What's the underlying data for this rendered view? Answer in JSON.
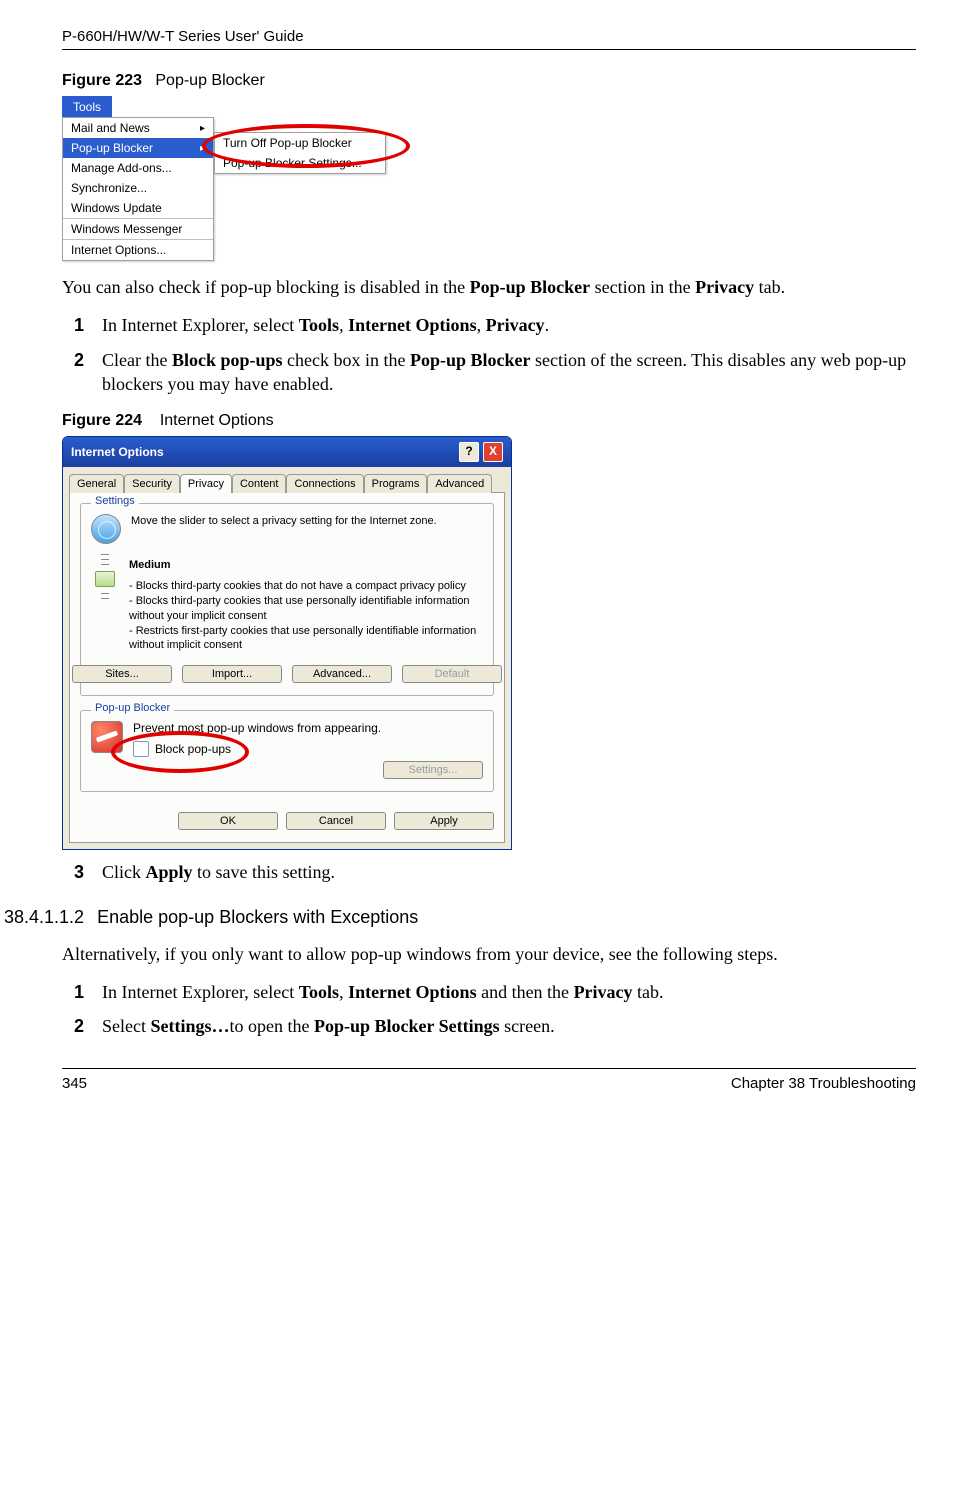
{
  "header": {
    "title": "P-660H/HW/W-T Series User' Guide"
  },
  "fig223": {
    "caption_num": "Figure 223",
    "caption_text": "Pop-up Blocker",
    "tools_label": "Tools",
    "menu": {
      "mail_and_news": "Mail and News",
      "popup_blocker": "Pop-up Blocker",
      "manage_addons": "Manage Add-ons...",
      "synchronize": "Synchronize...",
      "windows_update": "Windows Update",
      "windows_messenger": "Windows Messenger",
      "internet_options": "Internet Options...",
      "arrow": "▸"
    },
    "submenu": {
      "turn_off": "Turn Off Pop-up Blocker",
      "settings": "Pop-up Blocker Settings..."
    }
  },
  "para_after_fig223_a": "You can also check if pop-up blocking is disabled in the ",
  "para_after_fig223_b": "Pop-up Blocker",
  "para_after_fig223_c": " section in the ",
  "para_after_fig223_d": "Privacy",
  "para_after_fig223_e": " tab.",
  "steps1": {
    "s1": {
      "num": "1",
      "a": "In Internet Explorer, select ",
      "b": "Tools",
      "c": ", ",
      "d": "Internet Options",
      "e": ", ",
      "f": "Privacy",
      "g": "."
    },
    "s2": {
      "num": "2",
      "a": "Clear the ",
      "b": "Block pop-ups",
      "c": " check box in the ",
      "d": "Pop-up Blocker",
      "e": " section of the screen. This disables any web pop-up blockers you may have enabled."
    }
  },
  "fig224": {
    "caption_num": "Figure 224",
    "caption_text": "Internet Options",
    "dialog": {
      "title": "Internet Options",
      "help": "?",
      "close": "X",
      "tabs": {
        "general": "General",
        "security": "Security",
        "privacy": "Privacy",
        "content": "Content",
        "connections": "Connections",
        "programs": "Programs",
        "advanced": "Advanced"
      },
      "settings_title": "Settings",
      "settings_intro": "Move the slider to select a privacy setting for the Internet zone.",
      "level": "Medium",
      "bul1": "- Blocks third-party cookies that do not have a compact privacy policy",
      "bul2": "- Blocks third-party cookies that use personally identifiable information without your implicit consent",
      "bul3": "- Restricts first-party cookies that use personally identifiable information without implicit consent",
      "btn_sites": "Sites...",
      "btn_import": "Import...",
      "btn_advanced": "Advanced...",
      "btn_default": "Default",
      "popup_title": "Pop-up Blocker",
      "popup_intro": "Prevent most pop-up windows from appearing.",
      "cb_label": "Block pop-ups",
      "btn_settings": "Settings...",
      "btn_ok": "OK",
      "btn_cancel": "Cancel",
      "btn_apply": "Apply"
    }
  },
  "step3": {
    "num": "3",
    "a": "Click ",
    "b": "Apply",
    "c": " to save this setting."
  },
  "sec": {
    "num": "38.4.1.1.2",
    "title": "Enable pop-up Blockers with Exceptions"
  },
  "para_alt": "Alternatively, if you only want to allow pop-up windows from your device, see the following steps.",
  "steps2": {
    "s1": {
      "num": "1",
      "a": "In Internet Explorer, select ",
      "b": "Tools",
      "c": ", ",
      "d": "Internet Options",
      "e": " and then the ",
      "f": "Privacy",
      "g": " tab."
    },
    "s2": {
      "num": "2",
      "a": "Select ",
      "b": "Settings…",
      "c": "to open the ",
      "d": "Pop-up Blocker Settings",
      "e": " screen."
    }
  },
  "footer": {
    "page": "345",
    "chapter": "Chapter 38 Troubleshooting"
  }
}
